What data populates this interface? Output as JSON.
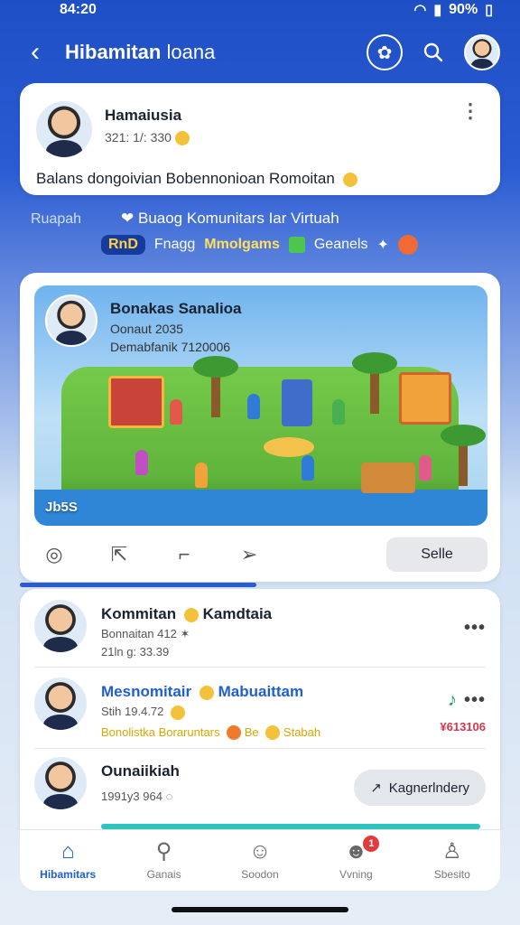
{
  "status": {
    "time": "84:20",
    "battery": "90%"
  },
  "header": {
    "title_bold": "Hibamitan",
    "title_light": "loana",
    "icons": [
      "badge-icon",
      "search-icon",
      "profile-avatar"
    ]
  },
  "post1": {
    "name": "Hamaiusia",
    "time": "321: 1/: 330",
    "text": "Balans dongoivian Bobennonioan Romoitan"
  },
  "banner": {
    "left_label": "Ruapah",
    "line1": "Buaog Komunitars Iar Virtuah",
    "tag": "RnD",
    "tag2": "Fnagg",
    "highlight": "Mmolgams",
    "tail": "Geanels"
  },
  "post2": {
    "name": "Bonakas Sanalioa",
    "line2": "Oonaut 2035",
    "line3": "Demabfanik 7120006",
    "caption": "Jb5S",
    "send_label": "Selle"
  },
  "list": [
    {
      "name": "Kommitan",
      "name2": "Kamdtaia",
      "sub": "Bonnaitan 412",
      "line3": "21ln g: 33.39"
    },
    {
      "name": "Mesnomitair",
      "name2": "Mabuaittam",
      "sub": "Stih 19.4.72",
      "line3": "Bonolistka Boraruntars",
      "line3b": "Be",
      "line3c": "Stabah",
      "side_value": "¥613106"
    },
    {
      "name": "Ounaiikiah",
      "sub": "1991y3 964",
      "button_label": "Kagnerlndery"
    }
  ],
  "tabs": [
    {
      "label": "Hibamitars",
      "icon": "home-icon",
      "active": true
    },
    {
      "label": "Ganais",
      "icon": "search-icon",
      "active": false
    },
    {
      "label": "Soodon",
      "icon": "face-icon",
      "active": false
    },
    {
      "label": "Vvning",
      "icon": "notifications-icon",
      "active": false,
      "badge": "1"
    },
    {
      "label": "Sbesito",
      "icon": "profile-icon",
      "active": false
    }
  ],
  "colors": {
    "primary": "#1f5fd1",
    "header_bg": "#2a5bd3",
    "accent_yellow": "#ffe05a"
  }
}
